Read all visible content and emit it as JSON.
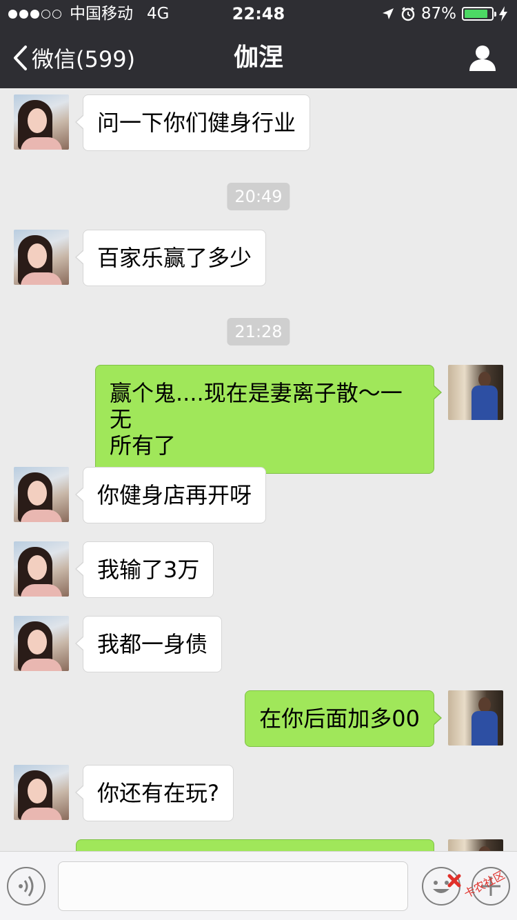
{
  "status_bar": {
    "carrier": "中国移动",
    "network": "4G",
    "time": "22:48",
    "battery": "87%",
    "battery_level": 0.87,
    "signal_bars_filled": 3,
    "signal_bars_total": 5,
    "icons": [
      "location-arrow-icon",
      "alarm-clock-icon",
      "battery-icon",
      "charging-bolt-icon"
    ]
  },
  "nav": {
    "back_label": "微信(599)",
    "title": "伽涅",
    "back_icon": "chevron-left-icon",
    "profile_icon": "user-profile-icon"
  },
  "messages": [
    {
      "type": "msg",
      "sender": "her",
      "text": "问一下你们健身行业"
    },
    {
      "type": "time",
      "text": "20:49"
    },
    {
      "type": "msg",
      "sender": "her",
      "text": "百家乐赢了多少"
    },
    {
      "type": "time",
      "text": "21:28"
    },
    {
      "type": "msg",
      "sender": "me",
      "line1": "赢个鬼....现在是妻离子散～一无",
      "line2": "所有了"
    },
    {
      "type": "msg",
      "sender": "her",
      "text": "你健身店再开呀"
    },
    {
      "type": "msg",
      "sender": "her",
      "text": "我输了3万"
    },
    {
      "type": "msg",
      "sender": "her",
      "text": "我都一身债"
    },
    {
      "type": "msg",
      "sender": "me",
      "text": "在你后面加多00"
    },
    {
      "type": "msg",
      "sender": "her",
      "text": "你还有在玩?"
    }
  ],
  "input_bar": {
    "voice_icon": "voice-icon",
    "emoji_icon": "emoji-icon",
    "plus_icon": "plus-icon",
    "text_value": ""
  },
  "watermark": {
    "text": "卡农社区"
  },
  "colors": {
    "topbar": "#2e2e33",
    "chat_background": "#ebebeb",
    "outgoing_bubble": "#a0e75a",
    "incoming_bubble": "#ffffff",
    "timestamp_pill": "#cfcfcf",
    "battery_fill": "#4cd964"
  }
}
